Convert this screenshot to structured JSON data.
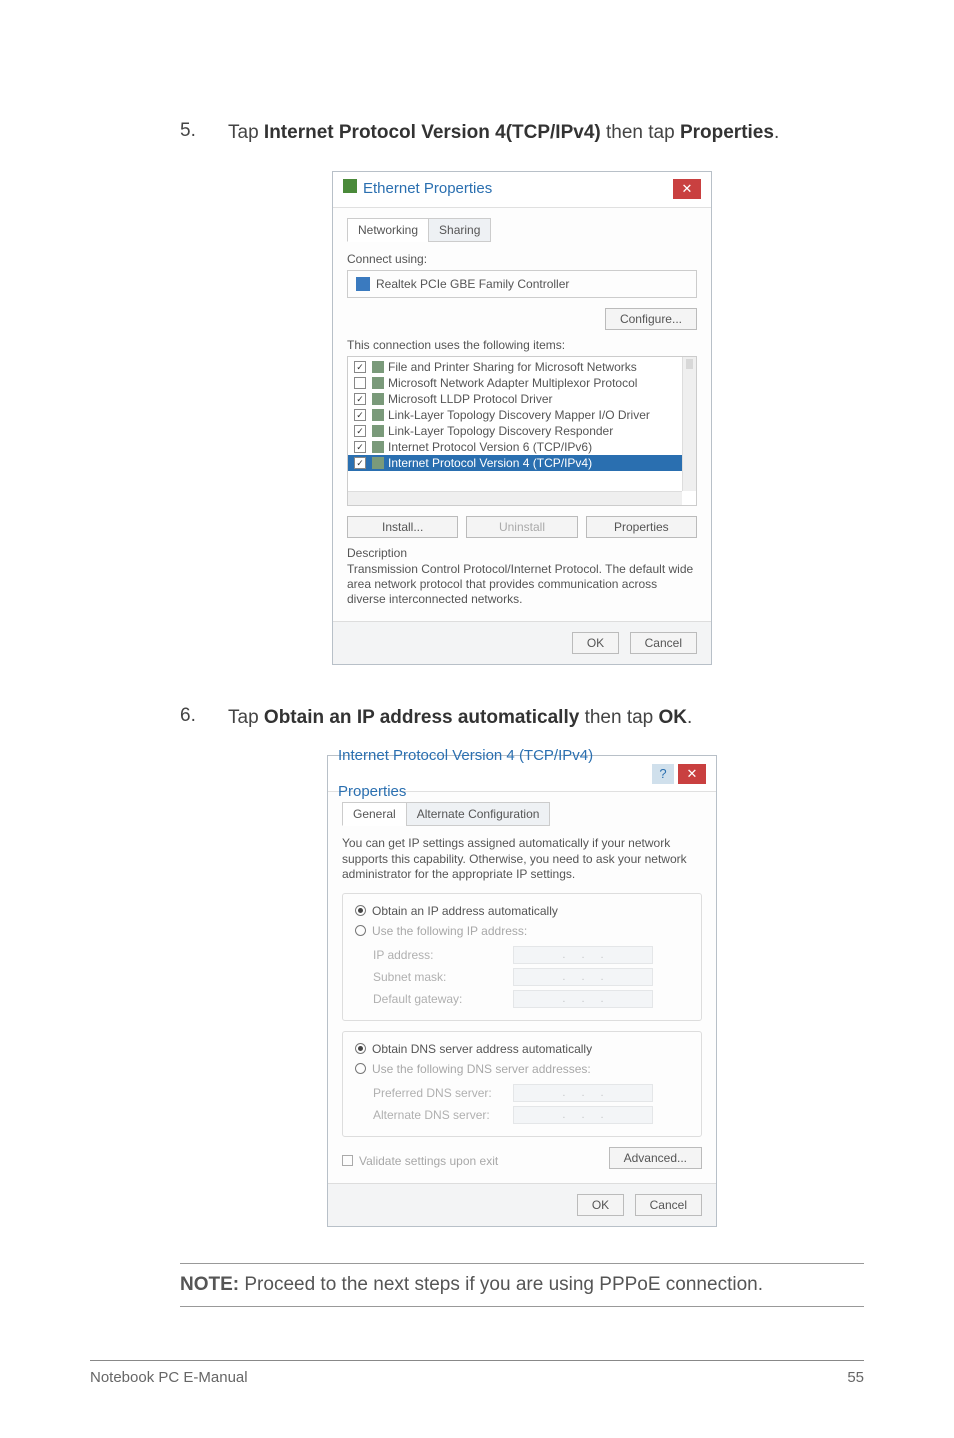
{
  "step1": {
    "num": "5.",
    "pre": "Tap ",
    "bold1": "Internet Protocol Version 4(TCP/IPv4)",
    "mid": " then tap ",
    "bold2": "Properties",
    "post": "."
  },
  "dialog1": {
    "title": "Ethernet Properties",
    "tabs": {
      "networking": "Networking",
      "sharing": "Sharing"
    },
    "connect_label": "Connect using:",
    "adapter": "Realtek PCIe GBE Family Controller",
    "configure": "Configure...",
    "list_label": "This connection uses the following items:",
    "items": [
      {
        "checked": true,
        "label": "File and Printer Sharing for Microsoft Networks"
      },
      {
        "checked": false,
        "label": "Microsoft Network Adapter Multiplexor Protocol"
      },
      {
        "checked": true,
        "label": "Microsoft LLDP Protocol Driver"
      },
      {
        "checked": true,
        "label": "Link-Layer Topology Discovery Mapper I/O Driver"
      },
      {
        "checked": true,
        "label": "Link-Layer Topology Discovery Responder"
      },
      {
        "checked": true,
        "label": "Internet Protocol Version 6 (TCP/IPv6)"
      },
      {
        "checked": true,
        "label": "Internet Protocol Version 4 (TCP/IPv4)",
        "selected": true
      }
    ],
    "install": "Install...",
    "uninstall": "Uninstall",
    "properties": "Properties",
    "desc_label": "Description",
    "desc_text": "Transmission Control Protocol/Internet Protocol. The default wide area network protocol that provides communication across diverse interconnected networks.",
    "ok": "OK",
    "cancel": "Cancel"
  },
  "step2": {
    "num": "6.",
    "pre": "Tap ",
    "bold1": "Obtain an IP address automatically",
    "mid": " then tap ",
    "bold2": "OK",
    "post": "."
  },
  "dialog2": {
    "title": "Internet Protocol Version 4 (TCP/IPv4) Properties",
    "tabs": {
      "general": "General",
      "alt": "Alternate Configuration"
    },
    "intro": "You can get IP settings assigned automatically if your network supports this capability. Otherwise, you need to ask your network administrator for the appropriate IP settings.",
    "ip_auto": "Obtain an IP address automatically",
    "ip_manual": "Use the following IP address:",
    "ip_address": "IP address:",
    "subnet": "Subnet mask:",
    "gateway": "Default gateway:",
    "dns_auto": "Obtain DNS server address automatically",
    "dns_manual": "Use the following DNS server addresses:",
    "pref_dns": "Preferred DNS server:",
    "alt_dns": "Alternate DNS server:",
    "validate": "Validate settings upon exit",
    "advanced": "Advanced...",
    "ok": "OK",
    "cancel": "Cancel"
  },
  "note": {
    "label": "NOTE:",
    "text": " Proceed to the next steps if you are using PPPoE connection."
  },
  "footer": {
    "left": "Notebook PC E-Manual",
    "right": "55"
  }
}
